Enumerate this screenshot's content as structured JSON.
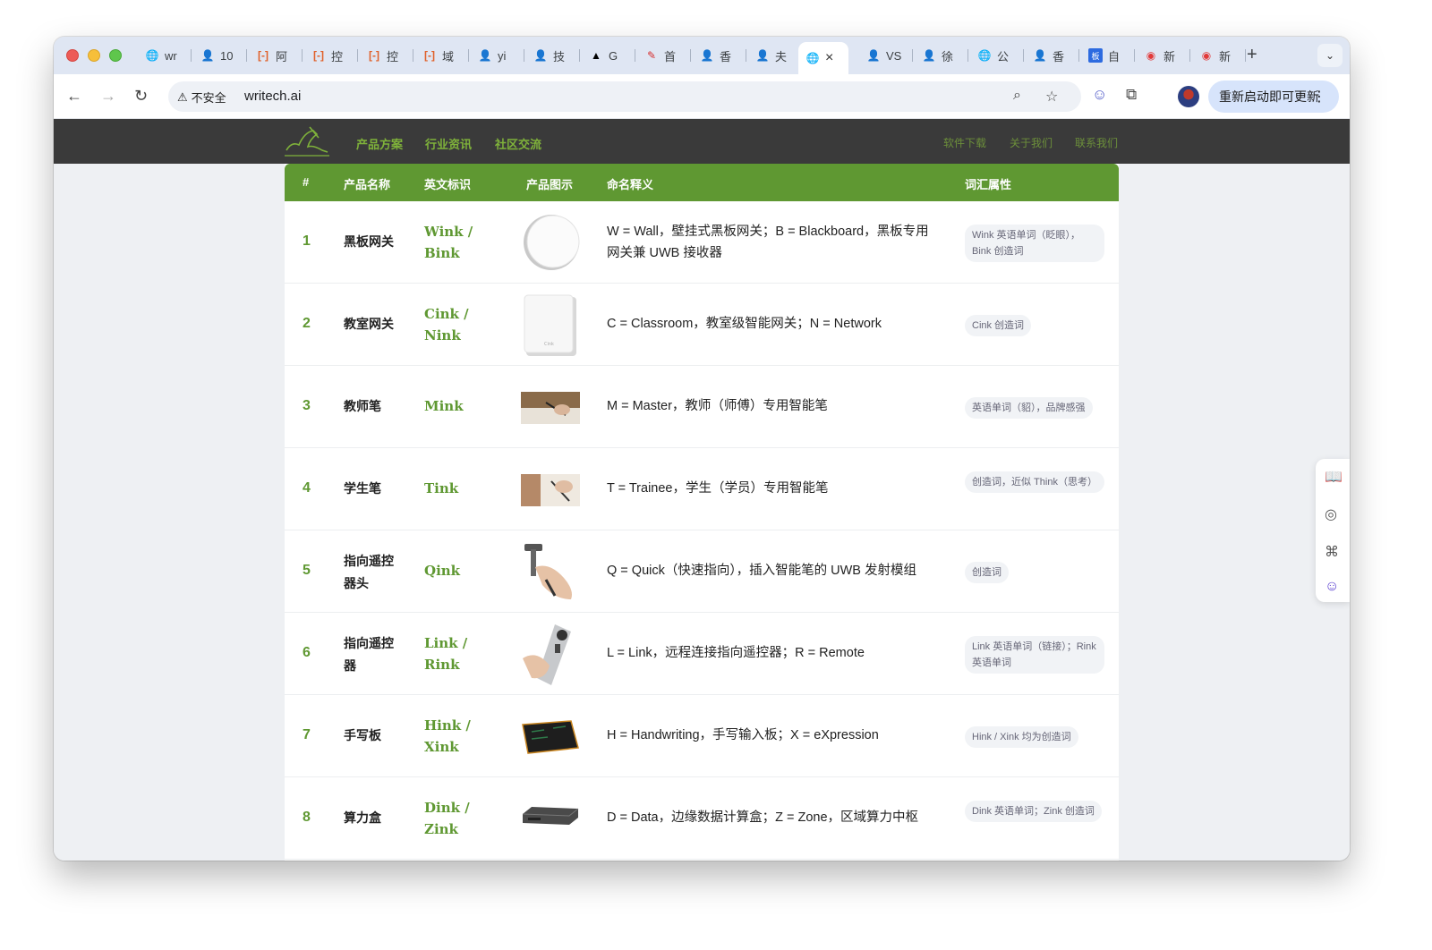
{
  "browser": {
    "tabs": [
      {
        "label": "wr",
        "icon": "globe-icon"
      },
      {
        "label": "10",
        "icon": "avatar-icon"
      },
      {
        "label": "阿",
        "icon": "bracket-icon"
      },
      {
        "label": "控",
        "icon": "bracket-icon"
      },
      {
        "label": "控",
        "icon": "bracket-icon"
      },
      {
        "label": "域",
        "icon": "bracket-icon"
      },
      {
        "label": "yi",
        "icon": "avatar-icon"
      },
      {
        "label": "技",
        "icon": "avatar-icon"
      },
      {
        "label": "G",
        "icon": "triangle-icon"
      },
      {
        "label": "首",
        "icon": "feather-icon"
      },
      {
        "label": "香",
        "icon": "avatar-icon"
      },
      {
        "label": "夫",
        "icon": "avatar-icon"
      },
      {
        "label": "",
        "icon": "globe-icon",
        "active": true
      },
      {
        "label": "VS",
        "icon": "avatar-icon"
      },
      {
        "label": "徐",
        "icon": "avatar-icon"
      },
      {
        "label": "公",
        "icon": "globe-icon"
      },
      {
        "label": "香",
        "icon": "avatar-icon"
      },
      {
        "label": "自",
        "icon": "board-icon"
      },
      {
        "label": "新",
        "icon": "weibo-icon"
      },
      {
        "label": "新",
        "icon": "weibo-icon"
      }
    ],
    "close_glyph": "×",
    "new_tab_glyph": "+",
    "insecure_label": "不安全",
    "url": "writech.ai",
    "update_label": "重新启动即可更新",
    "accent": "#5f9832"
  },
  "site": {
    "nav_left": [
      "产品方案",
      "行业资讯",
      "社区交流"
    ],
    "nav_right": [
      "软件下载",
      "关于我们",
      "联系我们"
    ]
  },
  "table": {
    "headers": {
      "num": "#",
      "name": "产品名称",
      "en": "英文标识",
      "img": "产品图示",
      "desc": "命名释义",
      "attr": "词汇属性"
    },
    "rows": [
      {
        "num": "1",
        "name": "黑板网关",
        "en": "Wink / Bink",
        "image": "round-gateway",
        "desc": "W = Wall，壁挂式黑板网关；B = Blackboard，黑板专用网关兼 UWB 接收器",
        "tag": "Wink 英语单词（眨眼），Bink 创造词"
      },
      {
        "num": "2",
        "name": "教室网关",
        "en": "Cink / Nink",
        "image": "square-gateway",
        "desc": "C = Classroom，教室级智能网关；N = Network",
        "tag": "Cink 创造词"
      },
      {
        "num": "3",
        "name": "教师笔",
        "en": "Mink",
        "image": "teacher-pen-photo",
        "desc": "M = Master，教师（师傅）专用智能笔",
        "tag": "英语单词（貂），品牌感强"
      },
      {
        "num": "4",
        "name": "学生笔",
        "en": "Tink",
        "image": "student-pen-photo",
        "desc": "T = Trainee，学生（学员）专用智能笔",
        "tag": "创造词，近似 Think（思考）"
      },
      {
        "num": "5",
        "name": "指向遥控器头",
        "en": "Qink",
        "image": "pointer-head-photo",
        "desc": "Q = Quick（快速指向），插入智能笔的 UWB 发射模组",
        "tag": "创造词"
      },
      {
        "num": "6",
        "name": "指向遥控器",
        "en": "Link / Rink",
        "image": "remote-photo",
        "desc": "L = Link，远程连接指向遥控器；R = Remote",
        "tag": "Link 英语单词（链接）；Rink 英语单词"
      },
      {
        "num": "7",
        "name": "手写板",
        "en": "Hink / Xink",
        "image": "writing-tablet-photo",
        "desc": "H = Handwriting，手写输入板；X = eXpression",
        "tag": "Hink / Xink 均为创造词"
      },
      {
        "num": "8",
        "name": "算力盒",
        "en": "Dink / Zink",
        "image": "compute-box-photo",
        "desc": "D = Data，边缘数据计算盒；Z = Zone，区域算力中枢",
        "tag": "Dink 英语单词；Zink 创造词"
      }
    ]
  }
}
